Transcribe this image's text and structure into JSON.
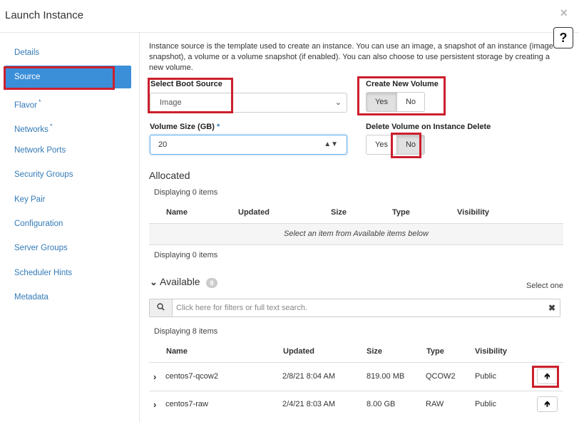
{
  "window": {
    "title": "Launch Instance",
    "close_glyph": "×",
    "help_glyph": "?"
  },
  "sidebar": {
    "items": [
      {
        "label": "Details",
        "required": false,
        "active": false
      },
      {
        "label": "Source",
        "required": false,
        "active": true
      },
      {
        "label": "Flavor",
        "required": true,
        "active": false
      },
      {
        "label": "Networks",
        "required": true,
        "active": false
      },
      {
        "label": "Network Ports",
        "required": false,
        "active": false
      },
      {
        "label": "Security Groups",
        "required": false,
        "active": false
      },
      {
        "label": "Key Pair",
        "required": false,
        "active": false
      },
      {
        "label": "Configuration",
        "required": false,
        "active": false
      },
      {
        "label": "Server Groups",
        "required": false,
        "active": false
      },
      {
        "label": "Scheduler Hints",
        "required": false,
        "active": false
      },
      {
        "label": "Metadata",
        "required": false,
        "active": false
      }
    ],
    "required_marker": "*"
  },
  "source": {
    "description": "Instance source is the template used to create an instance. You can use an image, a snapshot of an instance (image snapshot), a volume or a volume snapshot (if enabled). You can also choose to use persistent storage by creating a new volume.",
    "boot_source_label": "Select Boot Source",
    "boot_source_value": "Image",
    "create_volume_label": "Create New Volume",
    "create_volume_options": [
      "Yes",
      "No"
    ],
    "create_volume_selected": "Yes",
    "volume_size_label": "Volume Size (GB)",
    "volume_size_required": "*",
    "volume_size_value": "20",
    "delete_volume_label": "Delete Volume on Instance Delete",
    "delete_volume_options": [
      "Yes",
      "No"
    ],
    "delete_volume_selected": "No"
  },
  "allocated": {
    "title": "Allocated",
    "count_top": "Displaying 0 items",
    "columns": [
      "Name",
      "Updated",
      "Size",
      "Type",
      "Visibility"
    ],
    "empty_message": "Select an item from Available items below",
    "count_bottom": "Displaying 0 items"
  },
  "available": {
    "title": "Available",
    "badge": "8",
    "select_hint": "Select one",
    "search_placeholder": "Click here for filters or full text search.",
    "count": "Displaying 8 items",
    "columns": [
      "Name",
      "Updated",
      "Size",
      "Type",
      "Visibility"
    ],
    "rows": [
      {
        "name": "centos7-qcow2",
        "updated": "2/8/21 8:04 AM",
        "size": "819.00 MB",
        "type": "QCOW2",
        "visibility": "Public"
      },
      {
        "name": "centos7-raw",
        "updated": "2/4/21 8:03 AM",
        "size": "8.00 GB",
        "type": "RAW",
        "visibility": "Public"
      }
    ]
  },
  "colors": {
    "accent": "#3b8fd9",
    "highlight_box": "#cc1f2d",
    "link": "#337ab7"
  }
}
